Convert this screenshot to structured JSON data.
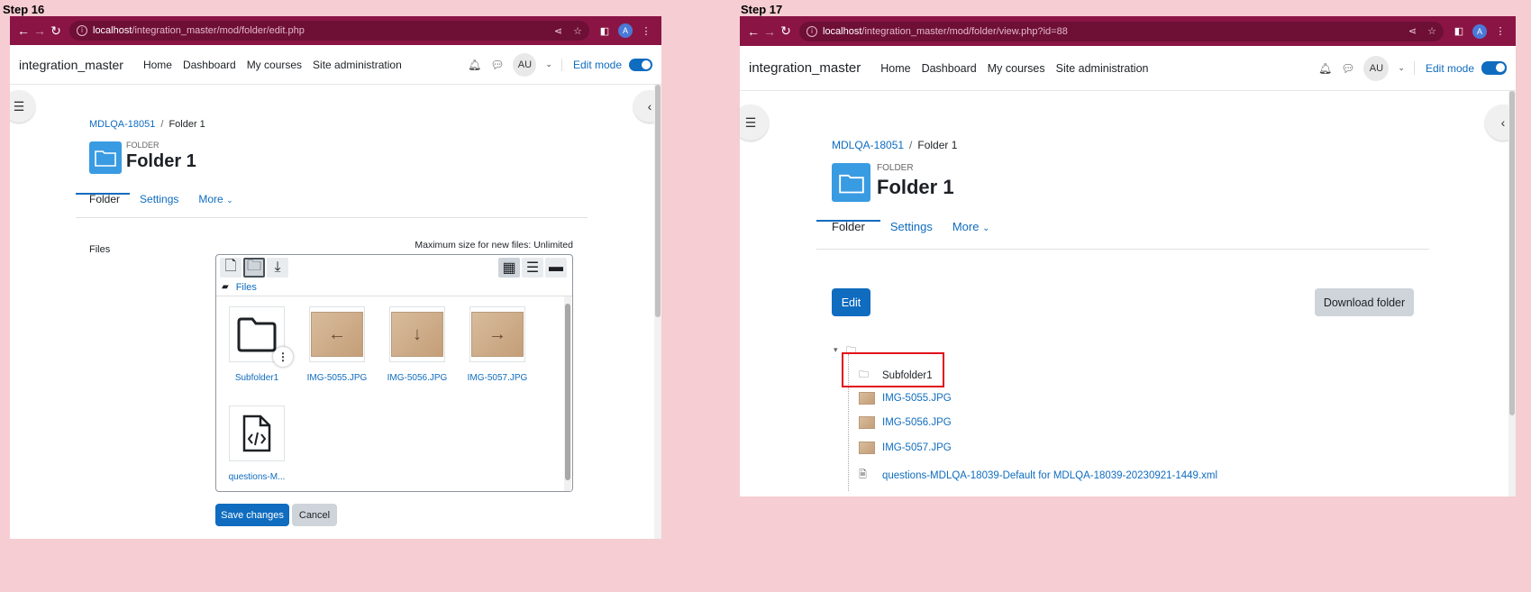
{
  "left": {
    "step_label": "Step 16",
    "url_host": "localhost",
    "url_path": "/integration_master/mod/folder/edit.php",
    "avatar_letter": "A",
    "site_name": "integration_master",
    "nav": [
      "Home",
      "Dashboard",
      "My courses",
      "Site administration"
    ],
    "user_initials": "AU",
    "edit_mode_label": "Edit mode",
    "breadcrumb": [
      "MDLQA-18051",
      "Folder 1"
    ],
    "activity_type": "FOLDER",
    "title": "Folder 1",
    "tabs": [
      "Folder",
      "Settings",
      "More"
    ],
    "files_label": "Files",
    "max_size": "Maximum size for new files: Unlimited",
    "fm_path": "Files",
    "files": [
      {
        "name": "Subfolder1",
        "kind": "folder"
      },
      {
        "name": "IMG-5055.JPG",
        "kind": "image",
        "arrow": "←"
      },
      {
        "name": "IMG-5056.JPG",
        "kind": "image",
        "arrow": "↓"
      },
      {
        "name": "IMG-5057.JPG",
        "kind": "image",
        "arrow": "→"
      },
      {
        "name": "questions-M...",
        "kind": "xml"
      }
    ],
    "save_label": "Save changes",
    "cancel_label": "Cancel"
  },
  "right": {
    "step_label": "Step 17",
    "url_host": "localhost",
    "url_path": "/integration_master/mod/folder/view.php?id=88",
    "avatar_letter": "A",
    "site_name": "integration_master",
    "nav": [
      "Home",
      "Dashboard",
      "My courses",
      "Site administration"
    ],
    "user_initials": "AU",
    "edit_mode_label": "Edit mode",
    "breadcrumb": [
      "MDLQA-18051",
      "Folder 1"
    ],
    "activity_type": "FOLDER",
    "title": "Folder 1",
    "tabs": [
      "Folder",
      "Settings",
      "More"
    ],
    "edit_label": "Edit",
    "download_label": "Download folder",
    "tree": [
      {
        "name": "Subfolder1",
        "kind": "folder"
      },
      {
        "name": "IMG-5055.JPG",
        "kind": "image"
      },
      {
        "name": "IMG-5056.JPG",
        "kind": "image"
      },
      {
        "name": "IMG-5057.JPG",
        "kind": "image"
      },
      {
        "name": "questions-MDLQA-18039-Default for MDLQA-18039-20230921-1449.xml",
        "kind": "xml"
      }
    ]
  },
  "colors": {
    "chrome": "#8a1545",
    "primary": "#0f6cbf",
    "highlight": "#e0101a",
    "background": "#f5cdd2"
  }
}
